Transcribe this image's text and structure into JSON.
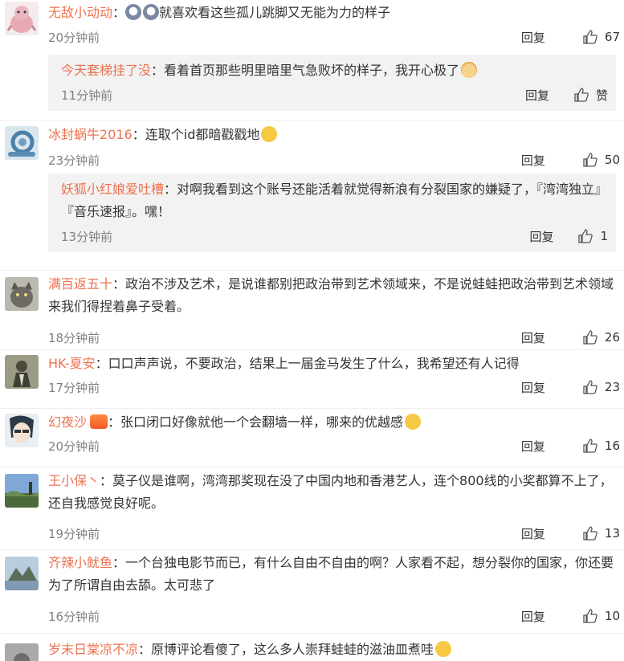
{
  "comments": [
    {
      "user": "无敌小动动",
      "text": "就喜欢看这些孤儿跳脚又无能为力的样子",
      "time": "20分钟前",
      "reply": "回复",
      "likes": "67",
      "sub": {
        "user": "今天套梯挂了没",
        "text": "看着首页那些明里暗里气急败坏的样子，我开心极了",
        "time": "11分钟前",
        "reply": "回复",
        "likes": "赞"
      }
    },
    {
      "user": "冰封蜗牛2016",
      "text": "连取个id都暗戳戳地",
      "time": "23分钟前",
      "reply": "回复",
      "likes": "50",
      "sub": {
        "user": "妖狐小红娘爱吐槽",
        "text": "对啊我看到这个账号还能活着就觉得新浪有分裂国家的嫌疑了，『湾湾独立』『音乐速报』。嘿！",
        "time": "13分钟前",
        "reply": "回复",
        "likes": "1"
      }
    },
    {
      "user": "满百返五十",
      "text": "政治不涉及艺术，是说谁都别把政治带到艺术领域来，不是说蛙蛙把政治带到艺术领域来我们得捏着鼻子受着。",
      "time": "18分钟前",
      "reply": "回复",
      "likes": "26"
    },
    {
      "user": "HK-夏安",
      "text": "口口声声说，不要政治，结果上一届金马发生了什么，我希望还有人记得",
      "time": "17分钟前",
      "reply": "回复",
      "likes": "23"
    },
    {
      "user": "幻夜沙",
      "text": "张口闭口好像就他一个会翻墙一样，哪来的优越感",
      "time": "20分钟前",
      "reply": "回复",
      "likes": "16"
    },
    {
      "user": "王小保丶",
      "text": "莫子仪是谁啊，湾湾那奖现在没了中国内地和香港艺人，连个800线的小奖都算不上了，还自我感觉良好呢。",
      "time": "19分钟前",
      "reply": "回复",
      "likes": "13"
    },
    {
      "user": "齐辣小鱿鱼",
      "text": "一个台独电影节而已，有什么自由不自由的啊？人家看不起，想分裂你的国家，你还要为了所谓自由去舔。太可悲了",
      "time": "16分钟前",
      "reply": "回复",
      "likes": "10"
    },
    {
      "user": "岁末日棠凉不凉",
      "text": "原博评论看傻了，这么多人崇拜蛙蛙的滋油皿煮哇"
    }
  ]
}
